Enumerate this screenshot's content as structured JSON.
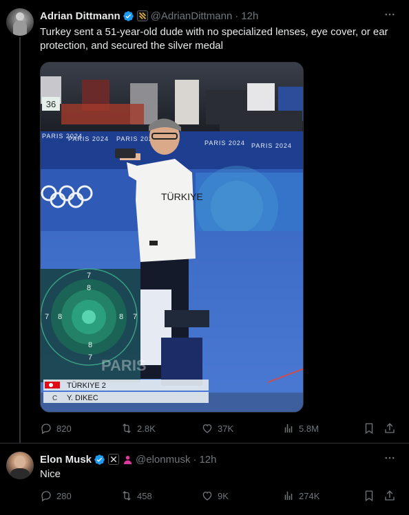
{
  "tweet1": {
    "author_name": "Adrian Dittmann",
    "handle": "@AdrianDittmann",
    "separator": "·",
    "time": "12h",
    "text": "Turkey sent a 51-year-old dude with no specialized lenses, eye cover, or ear protection, and secured the silver medal",
    "media": {
      "score_counter": "36",
      "banner_text": "PARIS 2024",
      "shirt_text": "TÜRKIYE",
      "target_rings_top": [
        "7",
        "8"
      ],
      "target_rings_left": [
        "7",
        "8"
      ],
      "target_rings_right": [
        "8",
        "7"
      ],
      "target_rings_bottom": [
        "8",
        "7"
      ],
      "overlay_row1": "TÜRKIYE 2",
      "overlay_row2_prefix": "C",
      "overlay_row2": "Y. DIKEC",
      "watermark": "PARIS"
    },
    "stats": {
      "replies": "820",
      "reposts": "2.8K",
      "likes": "37K",
      "views": "5.8M"
    },
    "colors": {
      "verified": "#1d9bf0",
      "badge_bg": "#e3b341"
    }
  },
  "tweet2": {
    "author_name": "Elon Musk",
    "handle": "@elonmusk",
    "separator": "·",
    "time": "12h",
    "text": "Nice",
    "stats": {
      "replies": "280",
      "reposts": "458",
      "likes": "9K",
      "views": "274K"
    },
    "colors": {
      "verified": "#1d9bf0",
      "affiliate_badge": "#e0399e"
    }
  },
  "icons": [
    "verified-icon",
    "more-icon",
    "reply-icon",
    "repost-icon",
    "like-icon",
    "views-icon",
    "bookmark-icon",
    "share-icon",
    "x-badge-icon",
    "affiliate-person-icon",
    "flag-badge-icon"
  ]
}
